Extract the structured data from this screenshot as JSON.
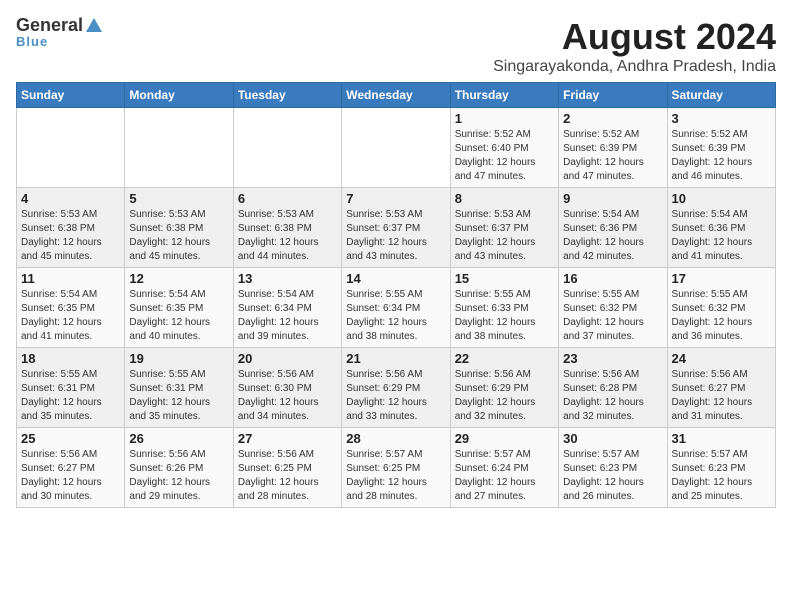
{
  "header": {
    "logo_line1": "General",
    "logo_line2": "Blue",
    "title": "August 2024",
    "subtitle": "Singarayakonda, Andhra Pradesh, India"
  },
  "days_of_week": [
    "Sunday",
    "Monday",
    "Tuesday",
    "Wednesday",
    "Thursday",
    "Friday",
    "Saturday"
  ],
  "weeks": [
    [
      {
        "day": "",
        "info": ""
      },
      {
        "day": "",
        "info": ""
      },
      {
        "day": "",
        "info": ""
      },
      {
        "day": "",
        "info": ""
      },
      {
        "day": "1",
        "info": "Sunrise: 5:52 AM\nSunset: 6:40 PM\nDaylight: 12 hours\nand 47 minutes."
      },
      {
        "day": "2",
        "info": "Sunrise: 5:52 AM\nSunset: 6:39 PM\nDaylight: 12 hours\nand 47 minutes."
      },
      {
        "day": "3",
        "info": "Sunrise: 5:52 AM\nSunset: 6:39 PM\nDaylight: 12 hours\nand 46 minutes."
      }
    ],
    [
      {
        "day": "4",
        "info": "Sunrise: 5:53 AM\nSunset: 6:38 PM\nDaylight: 12 hours\nand 45 minutes."
      },
      {
        "day": "5",
        "info": "Sunrise: 5:53 AM\nSunset: 6:38 PM\nDaylight: 12 hours\nand 45 minutes."
      },
      {
        "day": "6",
        "info": "Sunrise: 5:53 AM\nSunset: 6:38 PM\nDaylight: 12 hours\nand 44 minutes."
      },
      {
        "day": "7",
        "info": "Sunrise: 5:53 AM\nSunset: 6:37 PM\nDaylight: 12 hours\nand 43 minutes."
      },
      {
        "day": "8",
        "info": "Sunrise: 5:53 AM\nSunset: 6:37 PM\nDaylight: 12 hours\nand 43 minutes."
      },
      {
        "day": "9",
        "info": "Sunrise: 5:54 AM\nSunset: 6:36 PM\nDaylight: 12 hours\nand 42 minutes."
      },
      {
        "day": "10",
        "info": "Sunrise: 5:54 AM\nSunset: 6:36 PM\nDaylight: 12 hours\nand 41 minutes."
      }
    ],
    [
      {
        "day": "11",
        "info": "Sunrise: 5:54 AM\nSunset: 6:35 PM\nDaylight: 12 hours\nand 41 minutes."
      },
      {
        "day": "12",
        "info": "Sunrise: 5:54 AM\nSunset: 6:35 PM\nDaylight: 12 hours\nand 40 minutes."
      },
      {
        "day": "13",
        "info": "Sunrise: 5:54 AM\nSunset: 6:34 PM\nDaylight: 12 hours\nand 39 minutes."
      },
      {
        "day": "14",
        "info": "Sunrise: 5:55 AM\nSunset: 6:34 PM\nDaylight: 12 hours\nand 38 minutes."
      },
      {
        "day": "15",
        "info": "Sunrise: 5:55 AM\nSunset: 6:33 PM\nDaylight: 12 hours\nand 38 minutes."
      },
      {
        "day": "16",
        "info": "Sunrise: 5:55 AM\nSunset: 6:32 PM\nDaylight: 12 hours\nand 37 minutes."
      },
      {
        "day": "17",
        "info": "Sunrise: 5:55 AM\nSunset: 6:32 PM\nDaylight: 12 hours\nand 36 minutes."
      }
    ],
    [
      {
        "day": "18",
        "info": "Sunrise: 5:55 AM\nSunset: 6:31 PM\nDaylight: 12 hours\nand 35 minutes."
      },
      {
        "day": "19",
        "info": "Sunrise: 5:55 AM\nSunset: 6:31 PM\nDaylight: 12 hours\nand 35 minutes."
      },
      {
        "day": "20",
        "info": "Sunrise: 5:56 AM\nSunset: 6:30 PM\nDaylight: 12 hours\nand 34 minutes."
      },
      {
        "day": "21",
        "info": "Sunrise: 5:56 AM\nSunset: 6:29 PM\nDaylight: 12 hours\nand 33 minutes."
      },
      {
        "day": "22",
        "info": "Sunrise: 5:56 AM\nSunset: 6:29 PM\nDaylight: 12 hours\nand 32 minutes."
      },
      {
        "day": "23",
        "info": "Sunrise: 5:56 AM\nSunset: 6:28 PM\nDaylight: 12 hours\nand 32 minutes."
      },
      {
        "day": "24",
        "info": "Sunrise: 5:56 AM\nSunset: 6:27 PM\nDaylight: 12 hours\nand 31 minutes."
      }
    ],
    [
      {
        "day": "25",
        "info": "Sunrise: 5:56 AM\nSunset: 6:27 PM\nDaylight: 12 hours\nand 30 minutes."
      },
      {
        "day": "26",
        "info": "Sunrise: 5:56 AM\nSunset: 6:26 PM\nDaylight: 12 hours\nand 29 minutes."
      },
      {
        "day": "27",
        "info": "Sunrise: 5:56 AM\nSunset: 6:25 PM\nDaylight: 12 hours\nand 28 minutes."
      },
      {
        "day": "28",
        "info": "Sunrise: 5:57 AM\nSunset: 6:25 PM\nDaylight: 12 hours\nand 28 minutes."
      },
      {
        "day": "29",
        "info": "Sunrise: 5:57 AM\nSunset: 6:24 PM\nDaylight: 12 hours\nand 27 minutes."
      },
      {
        "day": "30",
        "info": "Sunrise: 5:57 AM\nSunset: 6:23 PM\nDaylight: 12 hours\nand 26 minutes."
      },
      {
        "day": "31",
        "info": "Sunrise: 5:57 AM\nSunset: 6:23 PM\nDaylight: 12 hours\nand 25 minutes."
      }
    ]
  ]
}
